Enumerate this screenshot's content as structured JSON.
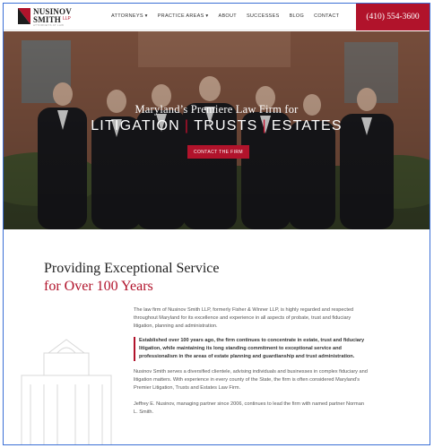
{
  "logo": {
    "line1": "NUSINOV",
    "line2": "SMITH",
    "llp": "LLP",
    "tagline": "ATTORNEYS AT LAW"
  },
  "nav": {
    "items": [
      "ATTORNEYS ▾",
      "PRACTICE AREAS ▾",
      "ABOUT",
      "SUCCESSES",
      "BLOG",
      "CONTACT"
    ]
  },
  "phone": "(410) 554-3600",
  "hero": {
    "subtitle": "Maryland’s Premiere Law Firm for",
    "title_1": "LITIGATION",
    "title_2": "TRUSTS",
    "title_3": "ESTATES",
    "separator": "|",
    "button": "CONTACT THE FIRM"
  },
  "intro": {
    "heading_line1": "Providing Exceptional Service",
    "heading_line2": "for Over 100 Years",
    "p1": "The law firm of Nusinov Smith LLP, formerly Fisher & Winner LLP, is highly regarded and respected throughout Maryland for its excellence and experience in all aspects of probate, trust and fiduciary litigation, planning and administration.",
    "p2": "Established over 100 years ago, the firm continues to concentrate in estate, trust and fiduciary litigation, while maintaining its long standing commitment to exceptional service and professionalism in the areas of estate planning and guardianship and trust administration.",
    "p3": "Nusinov Smith serves a diversified clientele, advising individuals and businesses in complex fiduciary and litigation matters. With experience in every county of the State, the firm is often considered Maryland’s Premier Litigation, Trusts and Estates Law Firm.",
    "p4": "Jeffrey E. Nusinov, managing partner since 2006, continues to lead the firm with named partner Norman L. Smith."
  },
  "colors": {
    "brand_red": "#b1132b",
    "text_dark": "#222222"
  }
}
